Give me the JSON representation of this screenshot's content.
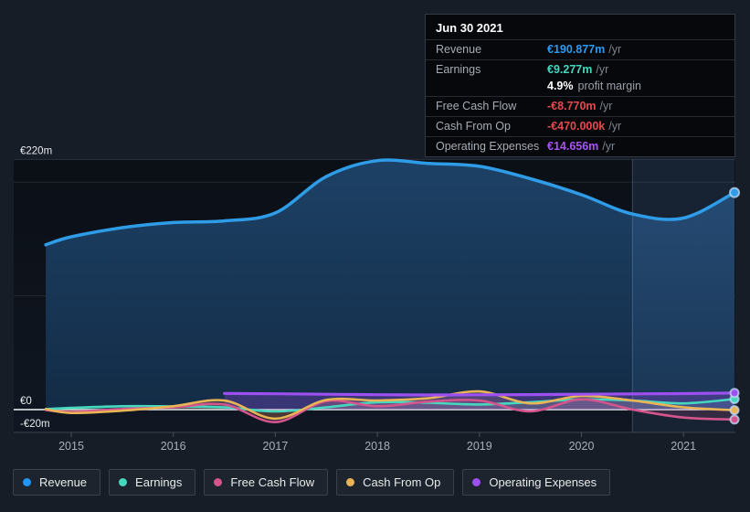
{
  "page": {
    "background": "#171d27"
  },
  "tooltip": {
    "date": "Jun 30 2021",
    "rows": [
      {
        "id": "revenue",
        "label": "Revenue",
        "value": "€190.877m",
        "suffix": "/yr",
        "color": "#2d9bf0"
      },
      {
        "id": "earnings",
        "label": "Earnings",
        "value": "€9.277m",
        "suffix": "/yr",
        "color": "#46d8bf",
        "secondary": {
          "value": "4.9%",
          "text": "profit margin"
        }
      },
      {
        "id": "free-cash-flow",
        "label": "Free Cash Flow",
        "value": "-€8.770m",
        "suffix": "/yr",
        "color": "#e5484d"
      },
      {
        "id": "cash-from-op",
        "label": "Cash From Op",
        "value": "-€470.000k",
        "suffix": "/yr",
        "color": "#e5484d"
      },
      {
        "id": "operating-expenses",
        "label": "Operating Expenses",
        "value": "€14.656m",
        "suffix": "/yr",
        "color": "#a855f7"
      }
    ]
  },
  "legend": [
    {
      "id": "revenue",
      "label": "Revenue",
      "color": "#2196f3"
    },
    {
      "id": "earnings",
      "label": "Earnings",
      "color": "#46d8bf"
    },
    {
      "id": "free-cash-flow",
      "label": "Free Cash Flow",
      "color": "#d4548e"
    },
    {
      "id": "cash-from-op",
      "label": "Cash From Op",
      "color": "#e8b455"
    },
    {
      "id": "operating-expenses",
      "label": "Operating Expenses",
      "color": "#9d50f0"
    }
  ],
  "chart_data": {
    "type": "line",
    "y_unit": "€m",
    "x_ticks": [
      2015,
      2016,
      2017,
      2018,
      2019,
      2020,
      2021
    ],
    "y_ticks": [
      {
        "value": 220,
        "label": "€220m"
      },
      {
        "value": 0,
        "label": "€0"
      },
      {
        "value": -20,
        "label": "-€20m"
      }
    ],
    "y_gridlines": [
      220,
      200,
      100
    ],
    "x_range": [
      2014.75,
      2021.5
    ],
    "y_range": [
      -20,
      220
    ],
    "highlight_band": {
      "x_start": 2020.5,
      "x_end": 2021.5
    },
    "x": [
      2014.75,
      2015,
      2015.5,
      2016,
      2016.5,
      2017,
      2017.5,
      2018,
      2018.5,
      2019,
      2019.5,
      2020,
      2020.5,
      2021,
      2021.5
    ],
    "series": [
      {
        "id": "revenue",
        "name": "Revenue",
        "color": "#2f9ce8",
        "area": "blue-gradient",
        "values": [
          145,
          152,
          160,
          164.5,
          166,
          173,
          205,
          219,
          216.5,
          214,
          203,
          189,
          172,
          168.5,
          190.877
        ]
      },
      {
        "id": "earnings",
        "name": "Earnings",
        "color": "#46d8bf",
        "values": [
          0.5,
          1.5,
          3,
          2.8,
          2,
          -1.6,
          2,
          6.5,
          6,
          4.5,
          6.5,
          9,
          8,
          5.5,
          9.277
        ]
      },
      {
        "id": "free-cash-flow",
        "name": "Free Cash Flow",
        "color": "#d4548e",
        "values": [
          -0.5,
          -2,
          0.5,
          2,
          4.5,
          -11,
          7.5,
          3,
          7,
          8,
          -1.5,
          9,
          0,
          -7,
          -8.77
        ]
      },
      {
        "id": "cash-from-op",
        "name": "Cash From Op",
        "color": "#e8b455",
        "values": [
          0.5,
          -3,
          -1,
          3,
          8,
          -8,
          8.5,
          8,
          10,
          16,
          5.5,
          12,
          8,
          2,
          -0.47
        ]
      },
      {
        "id": "operating-expenses",
        "name": "Operating Expenses",
        "color": "#9d50f0",
        "x": [
          2016.5,
          2017,
          2017.5,
          2018,
          2018.5,
          2019,
          2019.5,
          2020,
          2020.5,
          2021,
          2021.5
        ],
        "values": [
          14.2,
          13.9,
          13.5,
          13.1,
          12.9,
          13,
          13.2,
          13.5,
          13.8,
          14.1,
          14.656
        ]
      }
    ]
  }
}
